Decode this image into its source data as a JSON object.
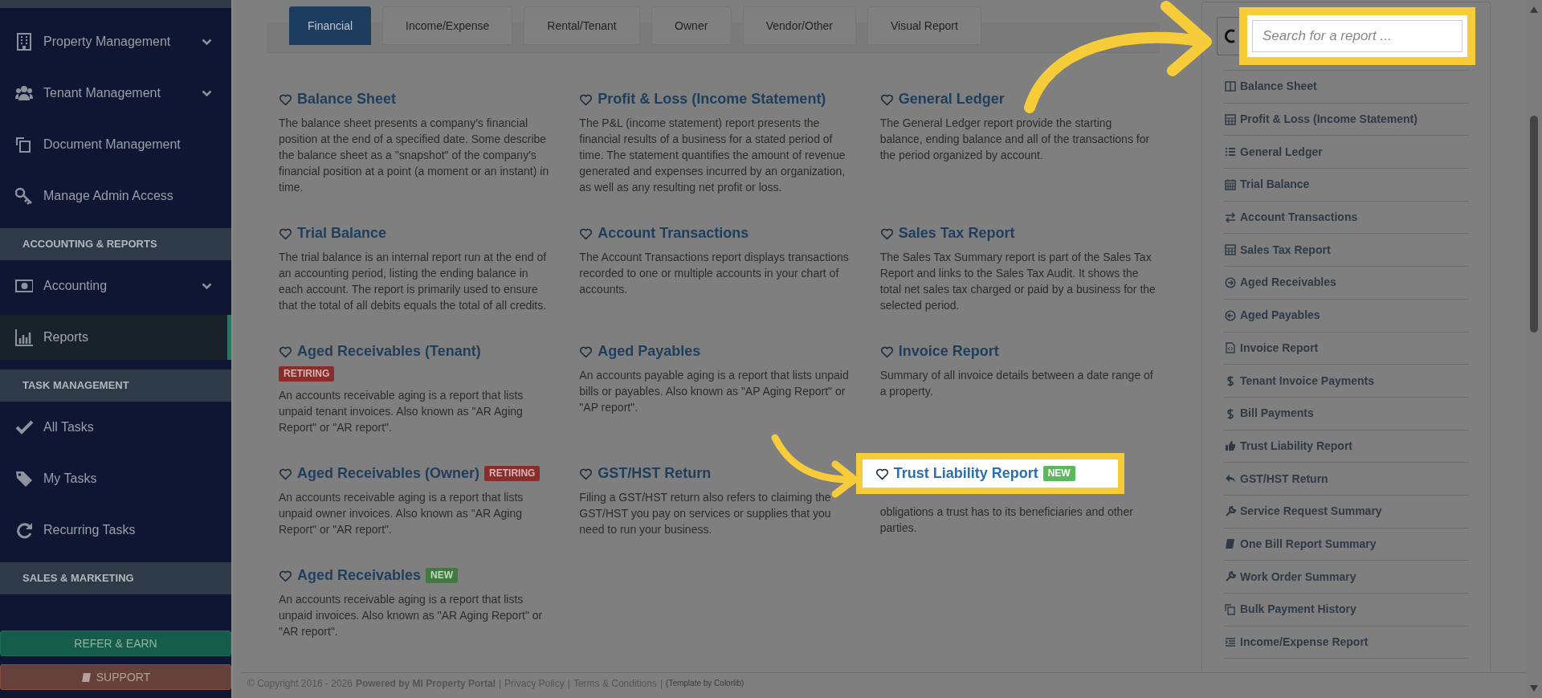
{
  "sidebar": {
    "items": [
      {
        "kind": "item",
        "label": "Property Management",
        "submenu": true,
        "selected": false
      },
      {
        "kind": "item",
        "label": "Tenant Management",
        "submenu": true,
        "selected": false
      },
      {
        "kind": "item",
        "label": "Document Management",
        "submenu": false,
        "selected": false
      },
      {
        "kind": "item",
        "label": "Manage Admin Access",
        "submenu": false,
        "selected": false
      },
      {
        "kind": "header",
        "label": "ACCOUNTING & REPORTS"
      },
      {
        "kind": "item",
        "label": "Accounting",
        "submenu": true,
        "selected": false
      },
      {
        "kind": "item",
        "label": "Reports",
        "submenu": false,
        "selected": true
      },
      {
        "kind": "header",
        "label": "TASK MANAGEMENT"
      },
      {
        "kind": "item",
        "label": "All Tasks",
        "submenu": false,
        "selected": false
      },
      {
        "kind": "item",
        "label": "My Tasks",
        "submenu": false,
        "selected": false
      },
      {
        "kind": "item",
        "label": "Recurring Tasks",
        "submenu": false,
        "selected": false
      },
      {
        "kind": "header",
        "label": "SALES & MARKETING"
      }
    ],
    "buttons": [
      {
        "kind": "refer",
        "label": "REFER & EARN"
      },
      {
        "kind": "support",
        "label": "SUPPORT"
      }
    ]
  },
  "tabs": [
    {
      "label": "Financial",
      "selected": true
    },
    {
      "label": "Income/Expense",
      "selected": false
    },
    {
      "label": "Rental/Tenant",
      "selected": false
    },
    {
      "label": "Owner",
      "selected": false
    },
    {
      "label": "Vendor/Other",
      "selected": false
    },
    {
      "label": "Visual Report",
      "selected": false
    }
  ],
  "reports": [
    {
      "title": "Balance Sheet",
      "description": "The balance sheet presents a company's financial position at the end of a specified date. Some describe the balance sheet as a \"snapshot\" of the company's financial position at a point (a moment or an instant) in time.",
      "highlighted": false
    },
    {
      "title": "Profit & Loss (Income Statement)",
      "description": "The P&L (income statement) report presents the financial results of a business for a stated period of time. The statement quantifies the amount of revenue generated and expenses incurred by an organization, as well as any resulting net profit or loss.",
      "highlighted": false
    },
    {
      "title": "General Ledger",
      "description": "The General Ledger report provide the starting balance, ending balance and all of the transactions for the period organized by account.",
      "highlighted": false
    },
    {
      "title": "Trial Balance",
      "description": "The trial balance is an internal report run at the end of an accounting period, listing the ending balance in each account. The report is primarily used to ensure that the total of all debits equals the total of all credits.",
      "highlighted": false
    },
    {
      "title": "Account Transactions",
      "description": "The Account Transactions report displays transactions recorded to one or multiple accounts in your chart of accounts.",
      "highlighted": false
    },
    {
      "title": "Sales Tax Report",
      "description": "The Sales Tax Summary report is part of the Sales Tax Report and links to the Sales Tax Audit. It shows the total net sales tax charged or paid by a business for the selected period.",
      "highlighted": false
    },
    {
      "title": "Aged Receivables (Tenant)",
      "badge": {
        "kind": "retiring",
        "label": "RETIRING"
      },
      "badge_below": true,
      "description": "An accounts receivable aging is a report that lists unpaid tenant invoices. Also known as \"AR Aging Report\" or \"AR report\".",
      "highlighted": false
    },
    {
      "title": "Aged Payables",
      "description": "An accounts payable aging is a report that lists unpaid bills or payables. Also known as \"AP Aging Report\" or \"AP report\".",
      "highlighted": false
    },
    {
      "title": "Invoice Report",
      "description": "Summary of all invoice details between a date range of a property.",
      "highlighted": false
    },
    {
      "title": "Aged Receivables (Owner)",
      "badge": {
        "kind": "retiring",
        "label": "RETIRING"
      },
      "badge_below": false,
      "description": "An accounts receivable aging is a report that lists unpaid owner invoices. Also known as \"AR Aging Report\" or \"AR report\".",
      "highlighted": false
    },
    {
      "title": "GST/HST Return",
      "description": "Filing a GST/HST return also refers to claiming the GST/HST you pay on services or supplies that you need to run your business.",
      "highlighted": false
    },
    {
      "title": "Trust Liability Report",
      "badge": {
        "kind": "new",
        "label": "NEW"
      },
      "badge_below": false,
      "description": "obligations a trust has to its beneficiaries and other parties.",
      "highlighted": true
    },
    {
      "title": "Aged Receivables",
      "badge": {
        "kind": "new",
        "label": "NEW"
      },
      "badge_below": false,
      "description": "An accounts receivable aging is a report that lists unpaid invoices. Also known as \"AR Aging Report\" or \"AR report\".",
      "highlighted": false
    }
  ],
  "search": {
    "placeholder": "Search for a report ...",
    "highlighted": true
  },
  "report_list": [
    "Balance Sheet",
    "Profit & Loss (Income Statement)",
    "General Ledger",
    "Trial Balance",
    "Account Transactions",
    "Sales Tax Report",
    "Aged Receivables",
    "Aged Payables",
    "Invoice Report",
    "Tenant Invoice Payments",
    "Bill Payments",
    "Trust Liability Report",
    "GST/HST Return",
    "Service Request Summary",
    "One Bill Report Summary",
    "Work Order Summary",
    "Bulk Payment History",
    "Income/Expense Report"
  ],
  "footer": {
    "copyright": "© Copyright 2016 - 2026",
    "powered": "Powered by MI Property Portal",
    "links": [
      "Privacy Policy",
      "Terms & Conditions"
    ],
    "separator": "|",
    "credit": "(Template by Colorlib)"
  }
}
